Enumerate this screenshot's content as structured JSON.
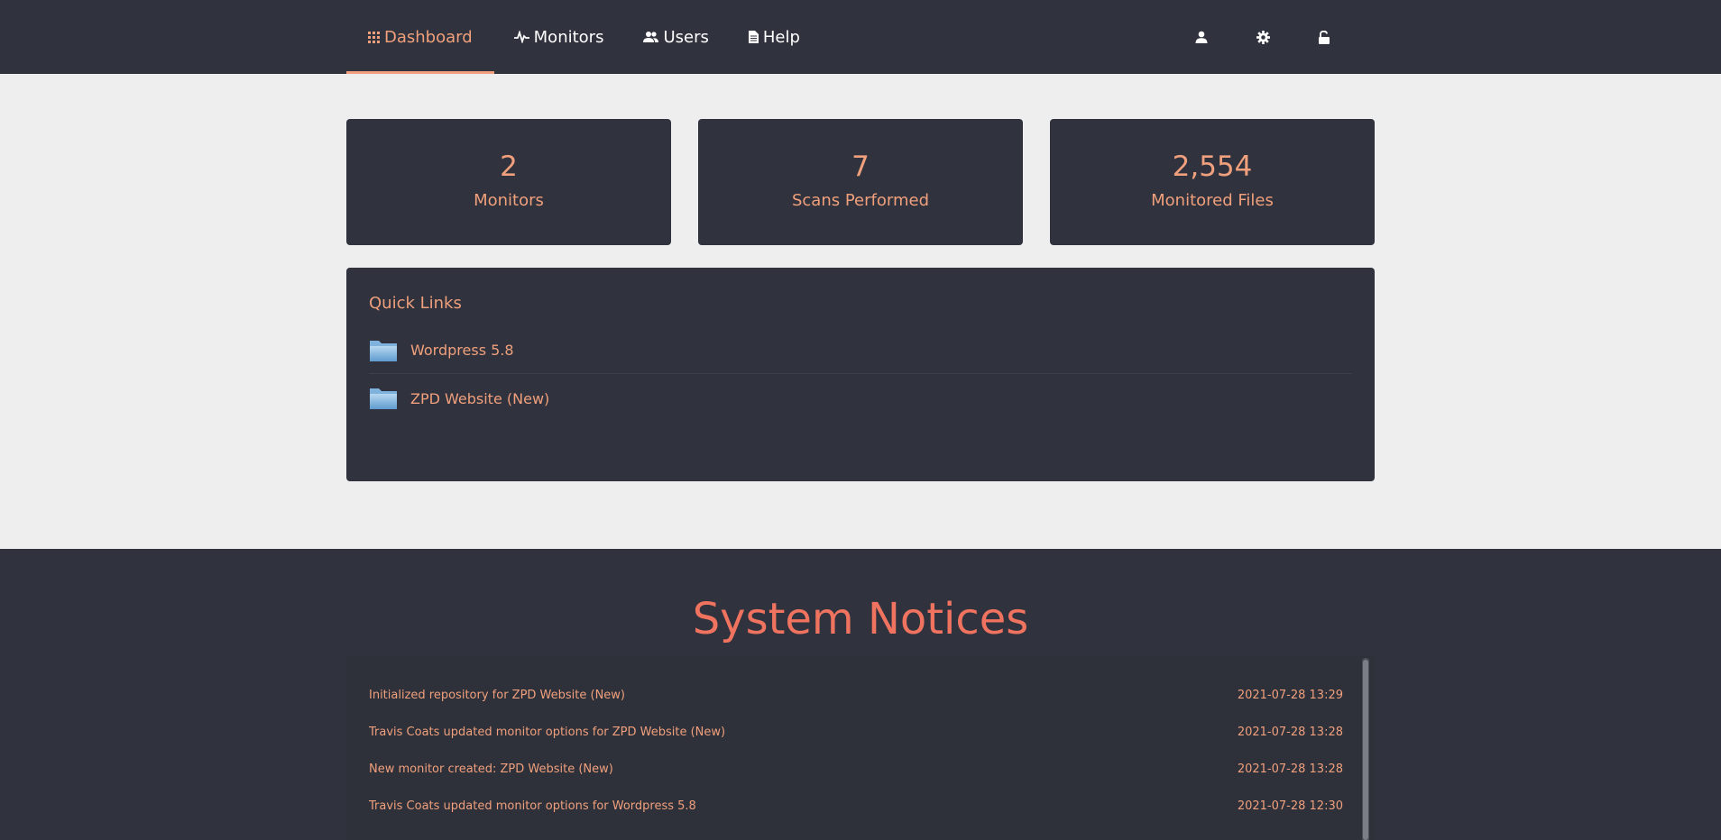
{
  "nav": {
    "tabs": [
      {
        "label": "Dashboard",
        "icon": "grid-dots-icon"
      },
      {
        "label": "Monitors",
        "icon": "pulse-icon"
      },
      {
        "label": "Users",
        "icon": "users-icon"
      },
      {
        "label": "Help",
        "icon": "document-icon"
      }
    ],
    "active_tab": "Dashboard",
    "right_icons": [
      "user-icon",
      "gear-icon",
      "unlock-icon"
    ]
  },
  "stats": [
    {
      "value": "2",
      "label": "Monitors"
    },
    {
      "value": "7",
      "label": "Scans Performed"
    },
    {
      "value": "2,554",
      "label": "Monitored Files"
    }
  ],
  "quick_links": {
    "title": "Quick Links",
    "items": [
      {
        "name": "Wordpress 5.8",
        "icon": "folder-icon"
      },
      {
        "name": "ZPD Website (New)",
        "icon": "folder-icon"
      }
    ]
  },
  "notices": {
    "title": "System Notices",
    "rows": [
      {
        "text": "Initialized repository for ZPD Website (New)",
        "time": "2021-07-28 13:29"
      },
      {
        "text": "Travis Coats updated monitor options for ZPD Website (New)",
        "time": "2021-07-28 13:28"
      },
      {
        "text": "New monitor created: ZPD Website (New)",
        "time": "2021-07-28 13:28"
      },
      {
        "text": "Travis Coats updated monitor options for Wordpress 5.8",
        "time": "2021-07-28 12:30"
      }
    ]
  },
  "colors": {
    "accent": "#f0a07c",
    "dark_bg": "#30323d",
    "notice_title": "#f07360",
    "page_bg": "#eeeeee"
  }
}
